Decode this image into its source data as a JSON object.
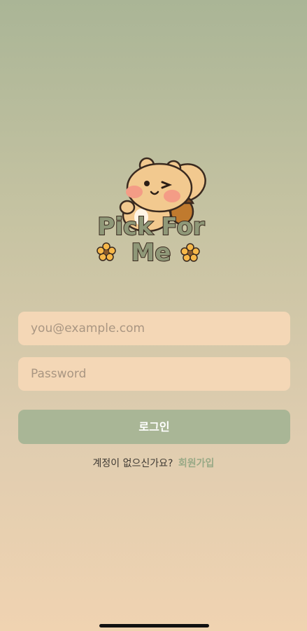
{
  "app": {
    "logo_line1": "Pick For",
    "logo_line2": "Me"
  },
  "login_form": {
    "email_placeholder": "you@example.com",
    "password_placeholder": "Password",
    "login_button_label": "로그인",
    "signup_prompt": "계정이 없으신가요?",
    "signup_link": "회원가입"
  },
  "colors": {
    "accent": "#a9b696",
    "field_bg": "#f4d7b6",
    "logo_text": "#8f9878"
  }
}
